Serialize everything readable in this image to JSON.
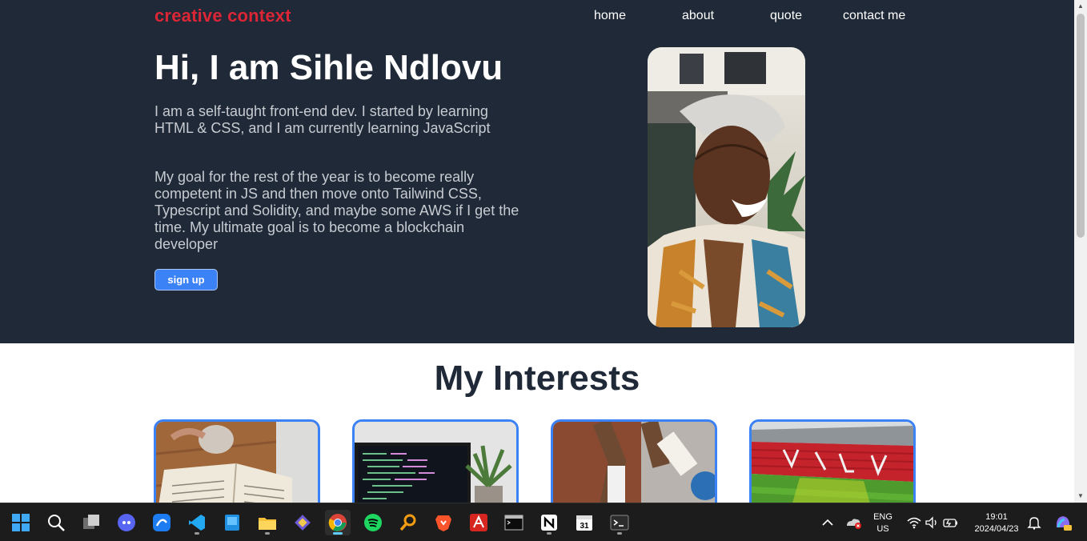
{
  "site": {
    "brand": "creative context",
    "nav": [
      "home",
      "about",
      "quote",
      "contact me"
    ],
    "hero": {
      "heading": "Hi, I am Sihle Ndlovu",
      "intro": "I am a self-taught front-end dev. I started by learning HTML & CSS, and I am currently learning JavaScript",
      "goal": "My goal for the rest of the year is to become really competent in JS and then move onto Tailwind CSS, Typescript and Solidity, and maybe some AWS if I get the time. My ultimate goal is to become a blockchain developer",
      "signup_label": "sign up"
    },
    "interests": {
      "title": "My Interests",
      "cards": [
        "reading-photo",
        "coding-laptop-photo",
        "football-photo",
        "stadium-photo"
      ]
    }
  },
  "taskbar": {
    "apps": [
      "start-icon",
      "search-icon",
      "task-view-icon",
      "discord-icon",
      "app-blue-icon",
      "vscode-icon",
      "blue-app-icon",
      "file-explorer-icon",
      "git-icon",
      "chrome-icon",
      "spotify-icon",
      "search-tool-icon",
      "brave-icon",
      "acrobat-icon",
      "cmd-icon",
      "notion-icon",
      "calendar-icon",
      "terminal-icon"
    ],
    "calendar_day": "31",
    "language": "ENG",
    "region": "US",
    "time": "19:01",
    "date": "2024/04/23"
  },
  "colors": {
    "hero_bg": "#1f2937",
    "brand": "#dc2635",
    "accent": "#3b82f6"
  }
}
